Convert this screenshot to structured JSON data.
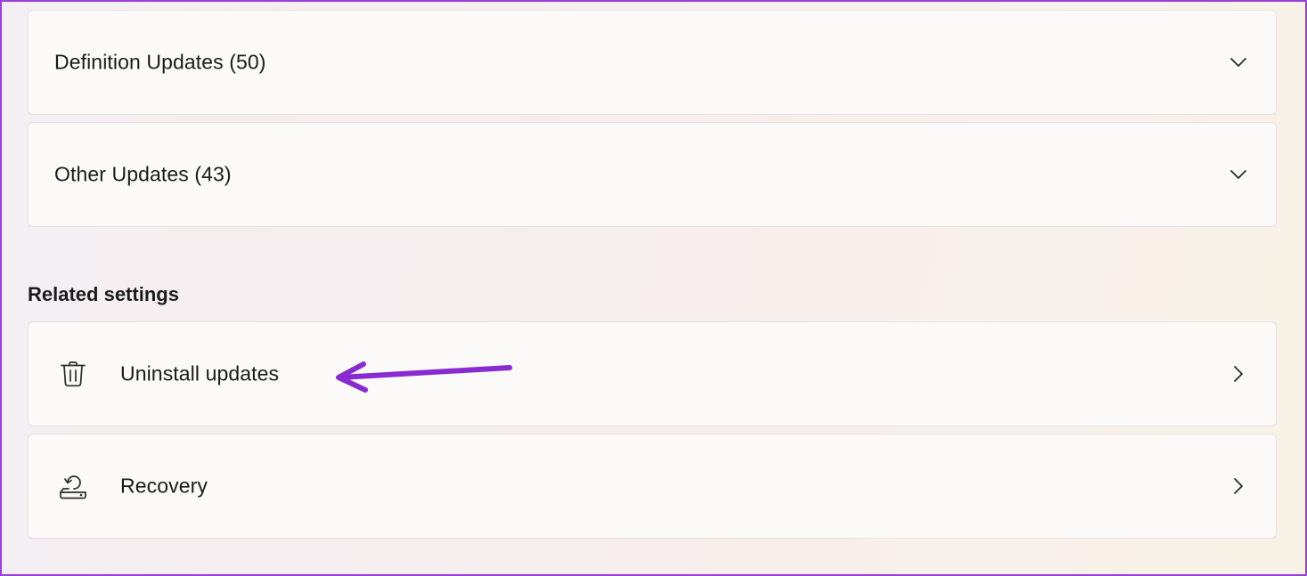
{
  "update_history": {
    "groups": [
      {
        "label": "Definition Updates (50)"
      },
      {
        "label": "Other Updates (43)"
      }
    ]
  },
  "related_settings": {
    "title": "Related settings",
    "items": [
      {
        "label": "Uninstall updates",
        "icon": "trash-icon"
      },
      {
        "label": "Recovery",
        "icon": "recovery-icon"
      }
    ]
  },
  "colors": {
    "annotation_arrow": "#8a2bd2",
    "frame_border": "#9b3fd6"
  }
}
